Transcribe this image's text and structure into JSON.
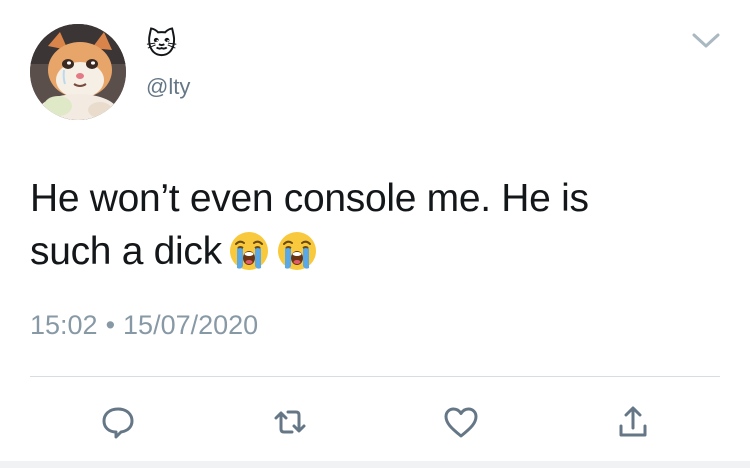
{
  "user": {
    "display_name_emoji": "🐱",
    "handle": "@lty",
    "avatar": "crying-cat-avatar"
  },
  "tweet": {
    "text_line1": "He won’t even console me. He is",
    "text_line2": "such a dick",
    "trailing_emojis": [
      "😭",
      "😭"
    ],
    "time": "15:02",
    "separator": "•",
    "date": "15/07/2020"
  },
  "actions": [
    {
      "name": "reply",
      "icon": "speech-bubble-icon"
    },
    {
      "name": "retweet",
      "icon": "retweet-icon"
    },
    {
      "name": "like",
      "icon": "heart-icon"
    },
    {
      "name": "share",
      "icon": "share-icon"
    }
  ],
  "colors": {
    "text": "#14171a",
    "secondary": "#657786",
    "meta": "#8899a6",
    "icon": "#657786",
    "divider": "#d8dde1"
  }
}
